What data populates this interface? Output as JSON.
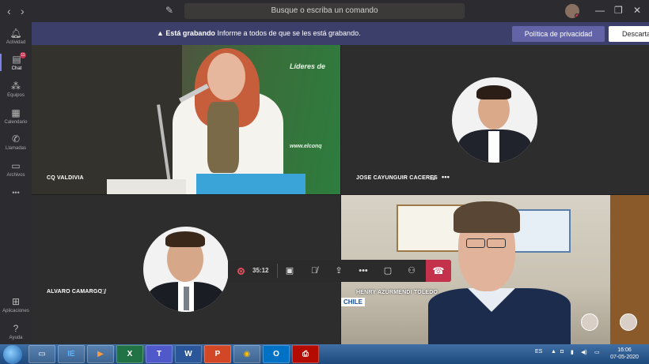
{
  "titlebar": {
    "search_placeholder": "Busque o escriba un comando",
    "back": "‹",
    "forward": "›",
    "minimize": "—",
    "maximize": "❐",
    "close": "✕"
  },
  "sidebar": {
    "items": [
      {
        "label": "Actividad",
        "icon": "bell-icon"
      },
      {
        "label": "Chat",
        "icon": "chat-icon",
        "badge": "11"
      },
      {
        "label": "Equipos",
        "icon": "teams-icon"
      },
      {
        "label": "Calendario",
        "icon": "calendar-icon"
      },
      {
        "label": "Llamadas",
        "icon": "phone-icon"
      },
      {
        "label": "Archivos",
        "icon": "files-icon"
      },
      {
        "label": "Aplicaciones",
        "icon": "apps-icon"
      },
      {
        "label": "Ayuda",
        "icon": "help-icon"
      }
    ],
    "more": "•••"
  },
  "banner": {
    "title": "Está grabando",
    "message": "Informe a todos de que se les está grabando.",
    "privacy_button": "Política de privacidad",
    "dismiss_button": "Descartar"
  },
  "participants": [
    {
      "name": "CQ VALDIVIA"
    },
    {
      "name": "JOSE CAYUNGUIR CACERES",
      "more": "•••"
    },
    {
      "name": "ALVARO CAMARGO"
    },
    {
      "name": "HENRY AZURMENDI TOLEDO"
    }
  ],
  "video_text": {
    "banner_line1": "Líderes de",
    "banner_line2": "www.elconq",
    "chile_sign": "CHILE"
  },
  "callbar": {
    "timer": "35:12"
  },
  "taskbar": {
    "apps": [
      "folder",
      "IE",
      "media",
      "X",
      "T",
      "W",
      "P",
      "chrome",
      "O",
      "pdf"
    ],
    "language": "ES",
    "time": "16:06",
    "date": "07-05-2020"
  },
  "colors": {
    "accent": "#6264a7",
    "banner_bg": "#3d3f6b",
    "hangup": "#c4314b",
    "record": "#e04b5c"
  }
}
